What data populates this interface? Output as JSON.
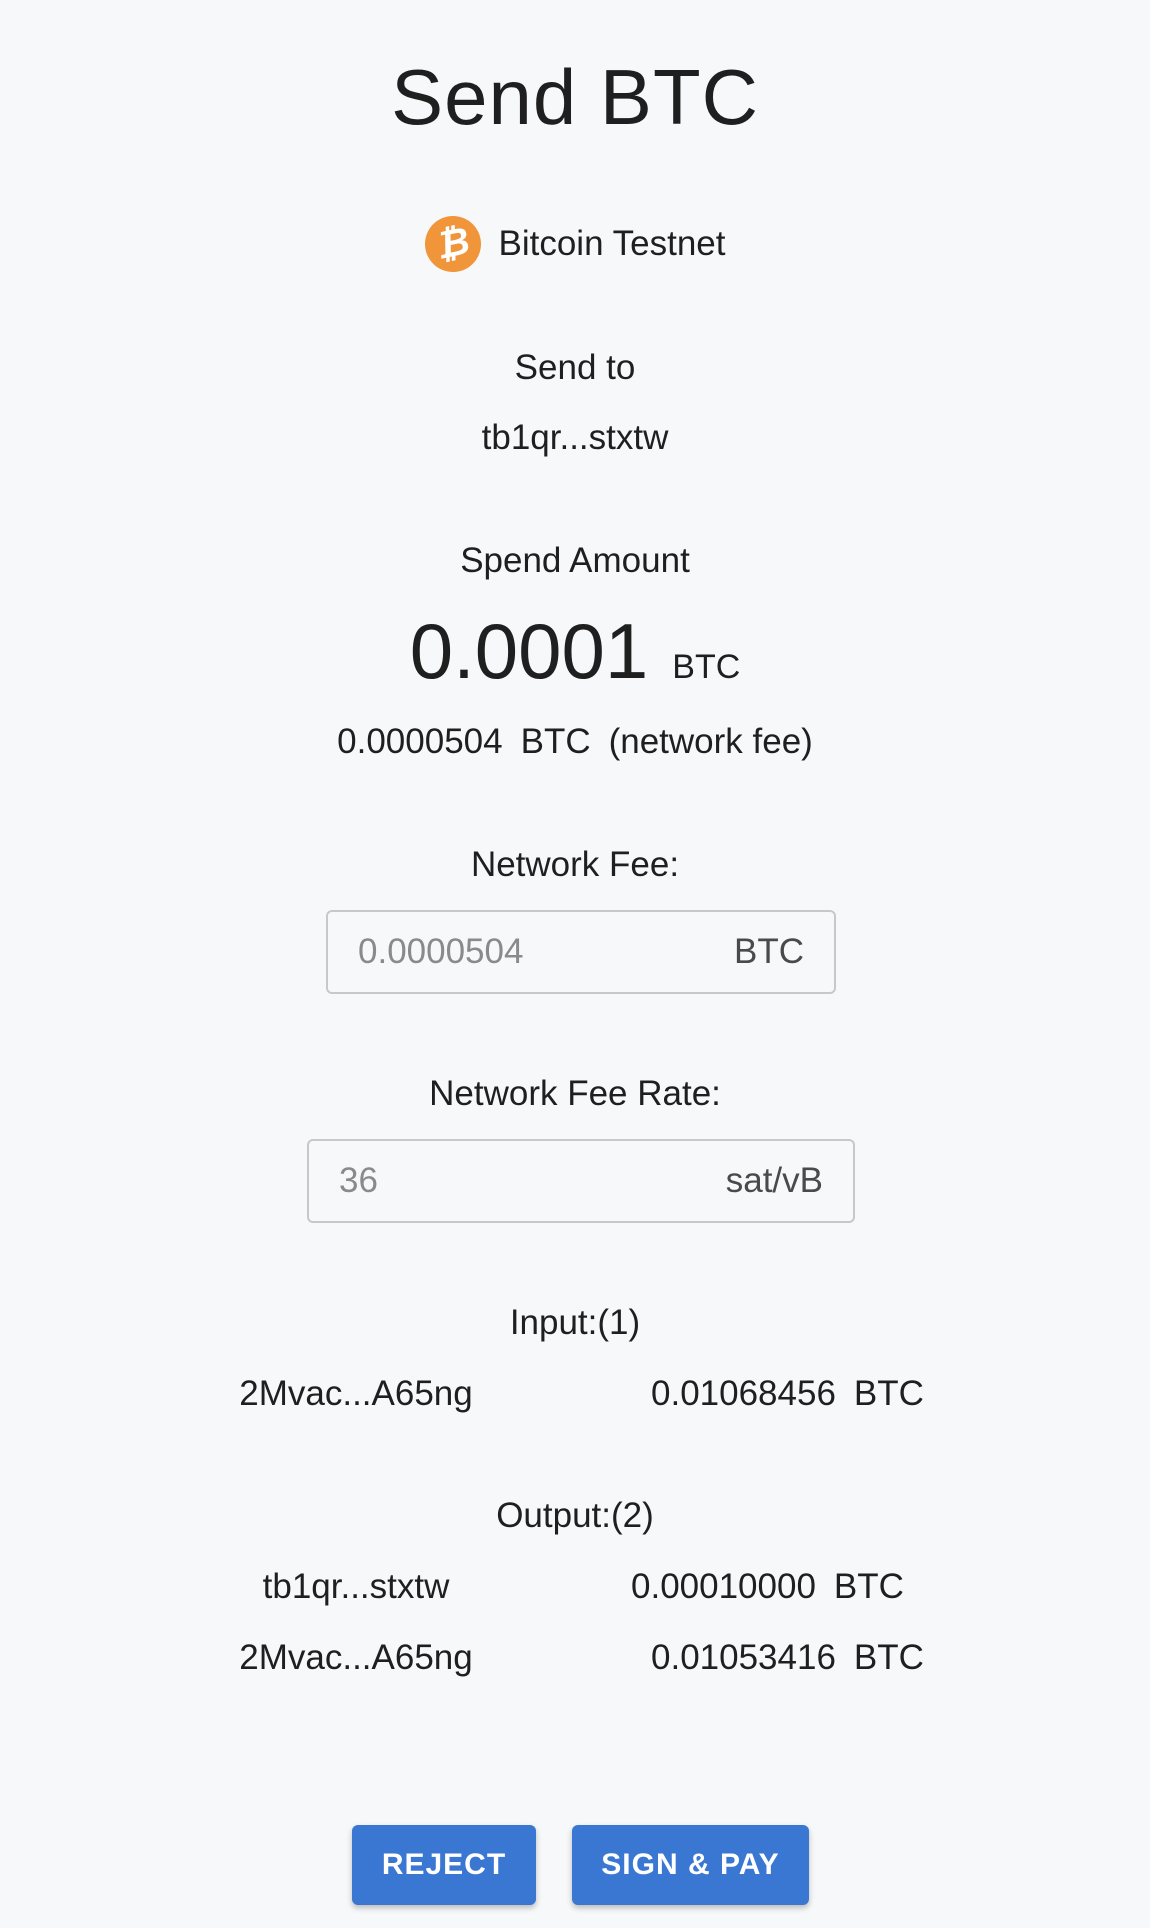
{
  "header": {
    "title": "Send BTC"
  },
  "network": {
    "icon": "bitcoin-icon",
    "icon_glyph": "₿",
    "icon_color": "#f0953a",
    "name": "Bitcoin Testnet"
  },
  "send_to": {
    "label": "Send to",
    "address": "tb1qr...stxtw"
  },
  "spend": {
    "label": "Spend Amount",
    "amount": "0.0001",
    "unit": "BTC",
    "fee_amount": "0.0000504",
    "fee_unit": "BTC",
    "fee_note": "(network fee)"
  },
  "network_fee": {
    "label": "Network Fee:",
    "placeholder": "0.0000504",
    "unit": "BTC"
  },
  "network_fee_rate": {
    "label": "Network Fee Rate:",
    "placeholder": "36",
    "unit": "sat/vB"
  },
  "inputs": {
    "title": "Input:(1)",
    "rows": [
      {
        "address": "2Mvac...A65ng",
        "amount": "0.01068456",
        "unit": "BTC"
      }
    ]
  },
  "outputs": {
    "title": "Output:(2)",
    "rows": [
      {
        "address": "tb1qr...stxtw",
        "amount": "0.00010000",
        "unit": "BTC"
      },
      {
        "address": "2Mvac...A65ng",
        "amount": "0.01053416",
        "unit": "BTC"
      }
    ]
  },
  "actions": {
    "reject_label": "REJECT",
    "sign_label": "SIGN & PAY",
    "button_color": "#3a77d3"
  }
}
